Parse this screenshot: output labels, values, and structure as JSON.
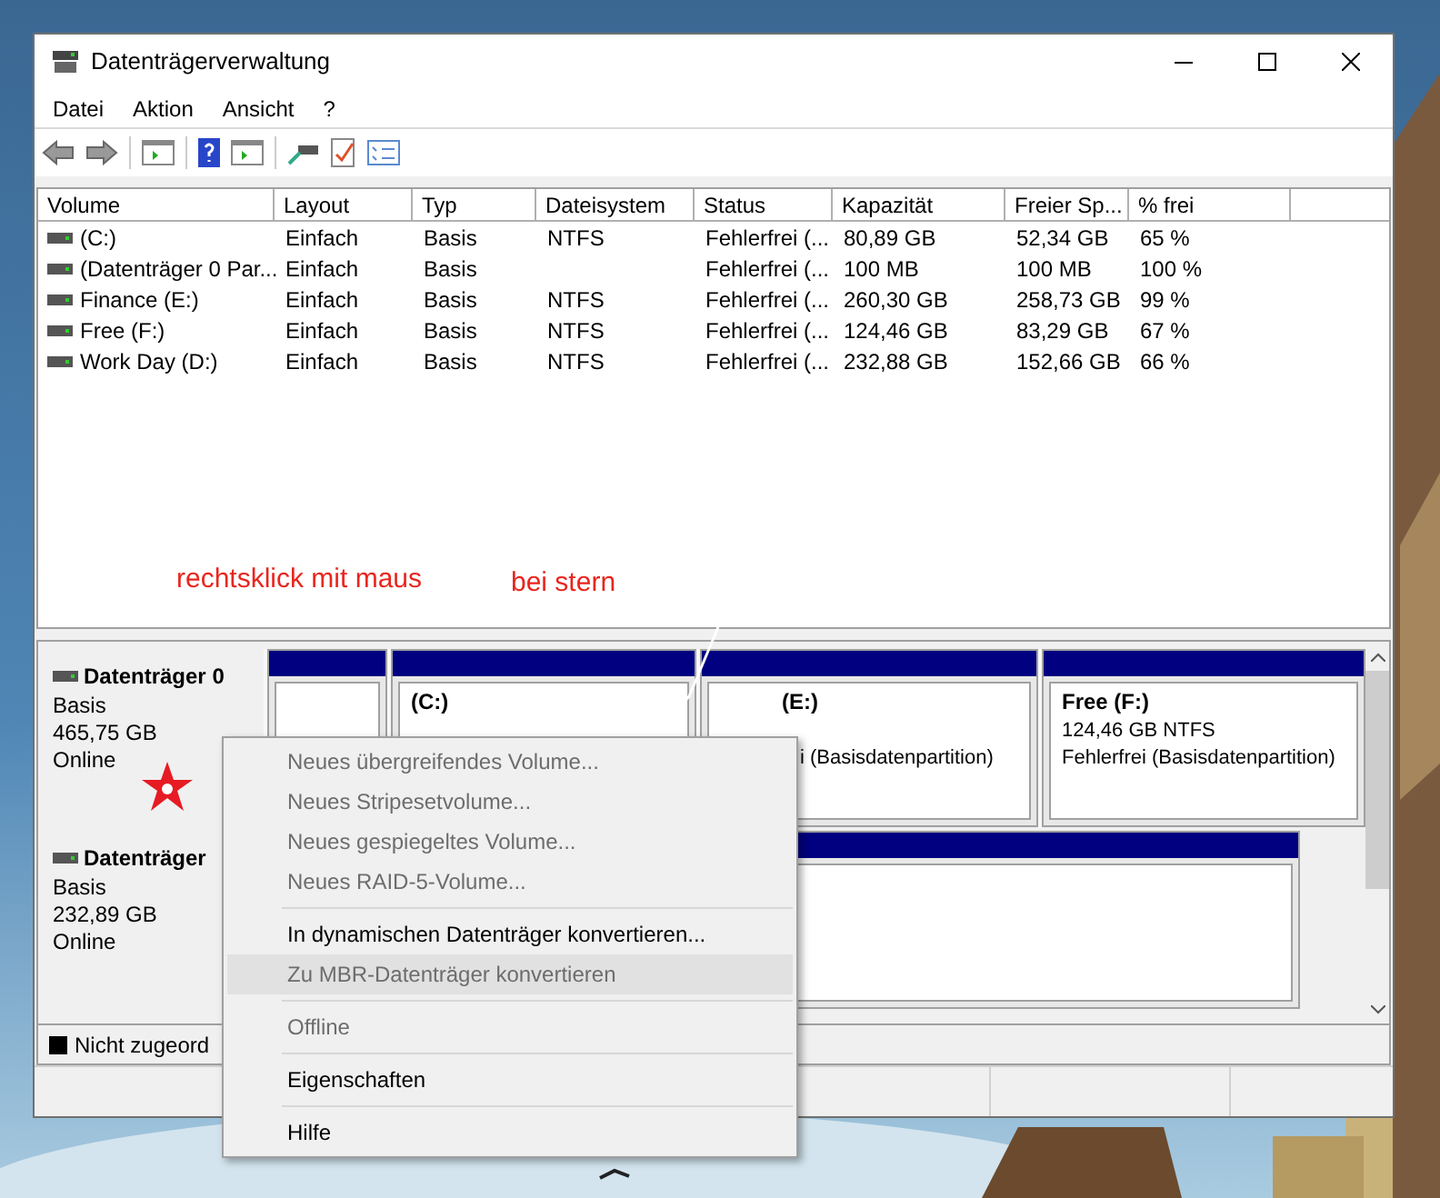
{
  "window": {
    "title": "Datenträgerverwaltung"
  },
  "menu": [
    "Datei",
    "Aktion",
    "Ansicht",
    "?"
  ],
  "table": {
    "columns": [
      "Volume",
      "Layout",
      "Typ",
      "Dateisystem",
      "Status",
      "Kapazität",
      "Freier Sp...",
      "% frei"
    ],
    "rows": [
      [
        "(C:)",
        "Einfach",
        "Basis",
        "NTFS",
        "Fehlerfrei (...",
        "80,89 GB",
        "52,34 GB",
        "65 %"
      ],
      [
        "(Datenträger 0 Par...",
        "Einfach",
        "Basis",
        "",
        "Fehlerfrei (...",
        "100 MB",
        "100 MB",
        "100 %"
      ],
      [
        "Finance (E:)",
        "Einfach",
        "Basis",
        "NTFS",
        "Fehlerfrei (...",
        "260,30 GB",
        "258,73 GB",
        "99 %"
      ],
      [
        "Free (F:)",
        "Einfach",
        "Basis",
        "NTFS",
        "Fehlerfrei (...",
        "124,46 GB",
        "83,29 GB",
        "67 %"
      ],
      [
        "Work Day (D:)",
        "Einfach",
        "Basis",
        "NTFS",
        "Fehlerfrei (...",
        "232,88 GB",
        "152,66 GB",
        "66 %"
      ]
    ]
  },
  "annotations": [
    "rechtsklick mit maus",
    "bei stern"
  ],
  "disks": [
    {
      "name": "Datenträger 0",
      "lines": [
        "Basis",
        "465,75 GB",
        "Online"
      ],
      "partitions": [
        {
          "kind": "full"
        },
        {
          "kind": "full",
          "title": "(C:)"
        },
        {
          "kind": "partial",
          "title": "(E:)",
          "lines": [
            "i (Basisdatenpartition)"
          ]
        },
        {
          "kind": "full",
          "title": "Free  (F:)",
          "lines": [
            "124,46 GB NTFS",
            "Fehlerfrei (Basisdatenpartition)"
          ]
        }
      ]
    },
    {
      "name": "Datenträger",
      "lines": [
        "Basis",
        "232,89 GB",
        "Online"
      ],
      "partitions": [
        {
          "kind": "full"
        }
      ]
    }
  ],
  "legend": {
    "label": "Nicht zugeord"
  },
  "context_menu": [
    {
      "kind": "item",
      "label": "Neues übergreifendes Volume...",
      "disabled": true,
      "selected": false
    },
    {
      "kind": "item",
      "label": "Neues Stripesetvolume...",
      "disabled": true,
      "selected": false
    },
    {
      "kind": "item",
      "label": "Neues gespiegeltes Volume...",
      "disabled": true,
      "selected": false
    },
    {
      "kind": "item",
      "label": "Neues RAID-5-Volume...",
      "disabled": true,
      "selected": false
    },
    {
      "kind": "separator"
    },
    {
      "kind": "item",
      "label": "In dynamischen Datenträger konvertieren...",
      "disabled": false,
      "selected": false
    },
    {
      "kind": "item",
      "label": "Zu MBR-Datenträger konvertieren",
      "disabled": true,
      "selected": true
    },
    {
      "kind": "separator"
    },
    {
      "kind": "item",
      "label": "Offline",
      "disabled": true,
      "selected": false
    },
    {
      "kind": "separator"
    },
    {
      "kind": "item",
      "label": "Eigenschaften",
      "disabled": false,
      "selected": false
    },
    {
      "kind": "separator"
    },
    {
      "kind": "item",
      "label": "Hilfe",
      "disabled": false,
      "selected": false
    }
  ]
}
